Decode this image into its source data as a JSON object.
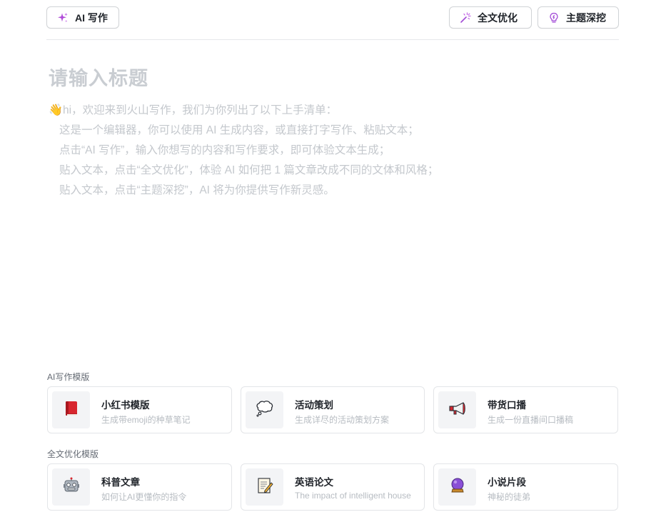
{
  "toolbar": {
    "ai_write_label": "AI 写作",
    "full_optimize_label": "全文优化",
    "topic_deep_label": "主题深挖"
  },
  "editor": {
    "title_placeholder": "请输入标题",
    "intro_lines": [
      "hi，欢迎来到火山写作，我们为你列出了以下上手清单：",
      "这是一个编辑器，你可以使用 AI 生成内容，或直接打字写作、粘贴文本；",
      "点击“AI 写作”，输入你想写的内容和写作要求，即可体验文本生成；",
      "贴入文本，点击“全文优化”，体验 AI 如何把 1 篇文章改成不同的文体和风格；",
      "贴入文本，点击“主题深挖”，AI 将为你提供写作新灵感。"
    ]
  },
  "templates": {
    "ai_section_label": "AI写作模版",
    "ai_cards": [
      {
        "title": "小红书模版",
        "desc": "生成带emoji的种草笔记",
        "icon": "red-book-icon"
      },
      {
        "title": "活动策划",
        "desc": "生成详尽的活动策划方案",
        "icon": "thought-bubble-icon"
      },
      {
        "title": "带货口播",
        "desc": "生成一份直播间口播稿",
        "icon": "megaphone-icon"
      }
    ],
    "opt_section_label": "全文优化模版",
    "opt_cards": [
      {
        "title": "科普文章",
        "desc": "如何让AI更懂你的指令",
        "icon": "robot-icon"
      },
      {
        "title": "英语论文",
        "desc": "The impact of intelligent house",
        "icon": "memo-icon"
      },
      {
        "title": "小说片段",
        "desc": "神秘的徒弟",
        "icon": "crystal-ball-icon"
      }
    ]
  },
  "colors": {
    "accent_purple": "#a24bd6",
    "placeholder_gray": "#c4c8cd"
  }
}
